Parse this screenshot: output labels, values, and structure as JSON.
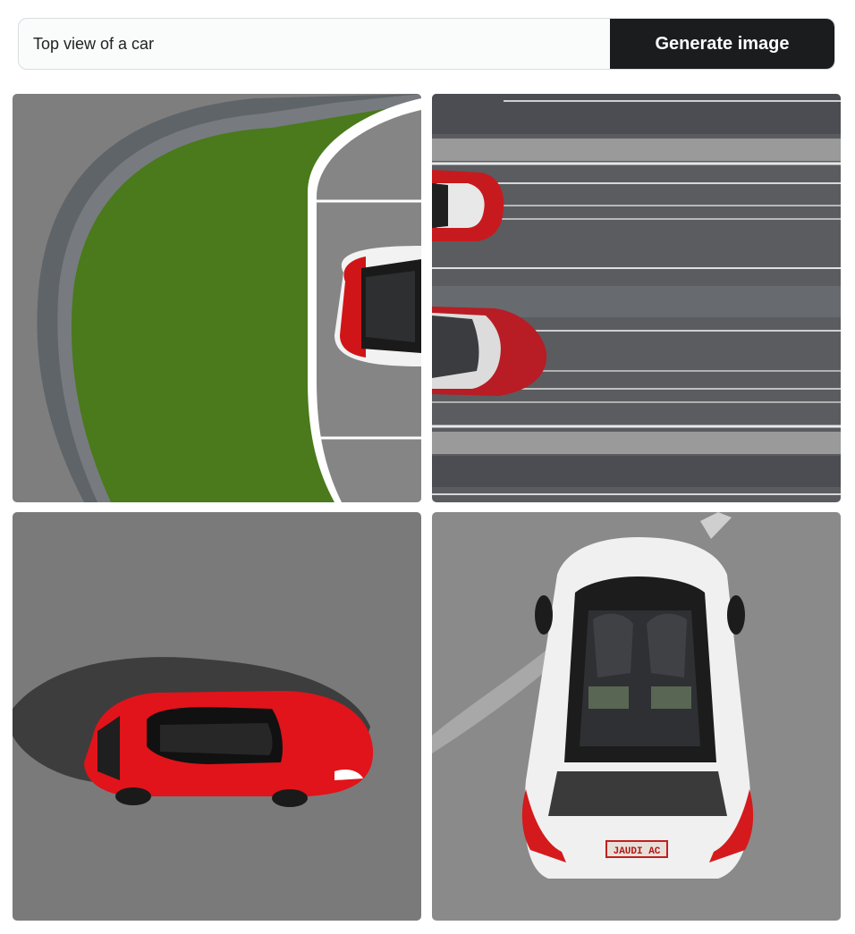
{
  "prompt": {
    "value": "Top view of a car",
    "placeholder": ""
  },
  "generate_button": {
    "label": "Generate image"
  },
  "results": {
    "images": [
      {
        "subject": "red-white car parked at curb beside grass"
      },
      {
        "subject": "two red cars on multi-lane road"
      },
      {
        "subject": "red sports car with shadow on asphalt"
      },
      {
        "subject": "white convertible car seen from above"
      }
    ],
    "plate_text": "JAUDI AC"
  },
  "colors": {
    "button_bg": "#1b1c1e",
    "grass": "#4a7a1c",
    "asphalt": "#7a7a7a",
    "car_red": "#e0141a"
  }
}
